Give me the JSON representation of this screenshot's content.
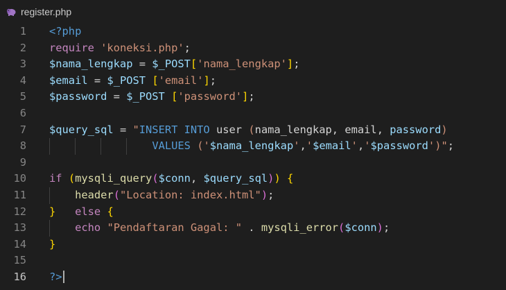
{
  "tab": {
    "filename": "register.php",
    "icon": "php-elephant-icon"
  },
  "colors": {
    "background": "#1e1e1e",
    "keyword": "#569cd6",
    "control": "#c586c0",
    "string": "#ce9178",
    "variable": "#9cdcfe",
    "function": "#dcdcaa",
    "bracket_gold": "#ffd700",
    "bracket_orchid": "#da70d6"
  },
  "active_line": 16,
  "lines": [
    {
      "num": "1",
      "tokens": [
        {
          "t": "<?php",
          "c": "kw"
        }
      ]
    },
    {
      "num": "2",
      "tokens": [
        {
          "t": "require ",
          "c": "ctl"
        },
        {
          "t": "'koneksi.php'",
          "c": "str"
        },
        {
          "t": ";",
          "c": "plain"
        }
      ]
    },
    {
      "num": "3",
      "tokens": [
        {
          "t": "$nama_lengkap",
          "c": "var"
        },
        {
          "t": " = ",
          "c": "plain"
        },
        {
          "t": "$_POST",
          "c": "var"
        },
        {
          "t": "[",
          "c": "b1"
        },
        {
          "t": "'nama_lengkap'",
          "c": "str"
        },
        {
          "t": "]",
          "c": "b1"
        },
        {
          "t": ";",
          "c": "plain"
        }
      ]
    },
    {
      "num": "4",
      "tokens": [
        {
          "t": "$email",
          "c": "var"
        },
        {
          "t": " = ",
          "c": "plain"
        },
        {
          "t": "$_POST",
          "c": "var"
        },
        {
          "t": " ",
          "c": "plain"
        },
        {
          "t": "[",
          "c": "b1"
        },
        {
          "t": "'email'",
          "c": "str"
        },
        {
          "t": "]",
          "c": "b1"
        },
        {
          "t": ";",
          "c": "plain"
        }
      ]
    },
    {
      "num": "5",
      "tokens": [
        {
          "t": "$password",
          "c": "var"
        },
        {
          "t": " = ",
          "c": "plain"
        },
        {
          "t": "$_POST",
          "c": "var"
        },
        {
          "t": " ",
          "c": "plain"
        },
        {
          "t": "[",
          "c": "b1"
        },
        {
          "t": "'password'",
          "c": "str"
        },
        {
          "t": "]",
          "c": "b1"
        },
        {
          "t": ";",
          "c": "plain"
        }
      ]
    },
    {
      "num": "6",
      "tokens": []
    },
    {
      "num": "7",
      "tokens": [
        {
          "t": "$query_sql",
          "c": "var"
        },
        {
          "t": " = ",
          "c": "plain"
        },
        {
          "t": "\"",
          "c": "str"
        },
        {
          "t": "INSERT INTO",
          "c": "kw"
        },
        {
          "t": " user ",
          "c": "plain"
        },
        {
          "t": "(",
          "c": "str"
        },
        {
          "t": "nama_lengkap",
          "c": "plain"
        },
        {
          "t": ", ",
          "c": "plain"
        },
        {
          "t": "email",
          "c": "plain"
        },
        {
          "t": ", ",
          "c": "plain"
        },
        {
          "t": "password",
          "c": "var"
        },
        {
          "t": ")",
          "c": "str"
        }
      ]
    },
    {
      "num": "8",
      "indent": 4,
      "tokens": [
        {
          "t": "VALUES",
          "c": "kw"
        },
        {
          "t": " (",
          "c": "str"
        },
        {
          "t": "'",
          "c": "str"
        },
        {
          "t": "$nama_lengkap",
          "c": "var"
        },
        {
          "t": "'",
          "c": "str"
        },
        {
          "t": ",",
          "c": "plain"
        },
        {
          "t": "'",
          "c": "str"
        },
        {
          "t": "$email",
          "c": "var"
        },
        {
          "t": "'",
          "c": "str"
        },
        {
          "t": ",",
          "c": "plain"
        },
        {
          "t": "'",
          "c": "str"
        },
        {
          "t": "$password",
          "c": "var"
        },
        {
          "t": "'",
          "c": "str"
        },
        {
          "t": ")\"",
          "c": "str"
        },
        {
          "t": ";",
          "c": "plain"
        }
      ]
    },
    {
      "num": "9",
      "tokens": []
    },
    {
      "num": "10",
      "tokens": [
        {
          "t": "if",
          "c": "ctl"
        },
        {
          "t": " ",
          "c": "plain"
        },
        {
          "t": "(",
          "c": "b1"
        },
        {
          "t": "mysqli_query",
          "c": "fn"
        },
        {
          "t": "(",
          "c": "b2"
        },
        {
          "t": "$conn",
          "c": "var"
        },
        {
          "t": ", ",
          "c": "plain"
        },
        {
          "t": "$query_sql",
          "c": "var"
        },
        {
          "t": ")",
          "c": "b2"
        },
        {
          "t": ")",
          "c": "b1"
        },
        {
          "t": " ",
          "c": "plain"
        },
        {
          "t": "{",
          "c": "b1"
        }
      ]
    },
    {
      "num": "11",
      "indent": 1,
      "tokens": [
        {
          "t": "header",
          "c": "fn"
        },
        {
          "t": "(",
          "c": "b2"
        },
        {
          "t": "\"Location: index.html\"",
          "c": "str"
        },
        {
          "t": ")",
          "c": "b2"
        },
        {
          "t": ";",
          "c": "plain"
        }
      ]
    },
    {
      "num": "12",
      "tokens": [
        {
          "t": "}",
          "c": "b1"
        },
        {
          "t": "   ",
          "c": "plain"
        },
        {
          "t": "else",
          "c": "ctl"
        },
        {
          "t": " ",
          "c": "plain"
        },
        {
          "t": "{",
          "c": "b1"
        }
      ]
    },
    {
      "num": "13",
      "indent": 1,
      "tokens": [
        {
          "t": "echo",
          "c": "ctl"
        },
        {
          "t": " ",
          "c": "plain"
        },
        {
          "t": "\"Pendaftaran Gagal: \"",
          "c": "str"
        },
        {
          "t": " . ",
          "c": "plain"
        },
        {
          "t": "mysqli_error",
          "c": "fn"
        },
        {
          "t": "(",
          "c": "b2"
        },
        {
          "t": "$conn",
          "c": "var"
        },
        {
          "t": ")",
          "c": "b2"
        },
        {
          "t": ";",
          "c": "plain"
        }
      ]
    },
    {
      "num": "14",
      "tokens": [
        {
          "t": "}",
          "c": "b1"
        }
      ]
    },
    {
      "num": "15",
      "tokens": []
    },
    {
      "num": "16",
      "tokens": [
        {
          "t": "?>",
          "c": "kw"
        }
      ],
      "cursor": true
    }
  ]
}
